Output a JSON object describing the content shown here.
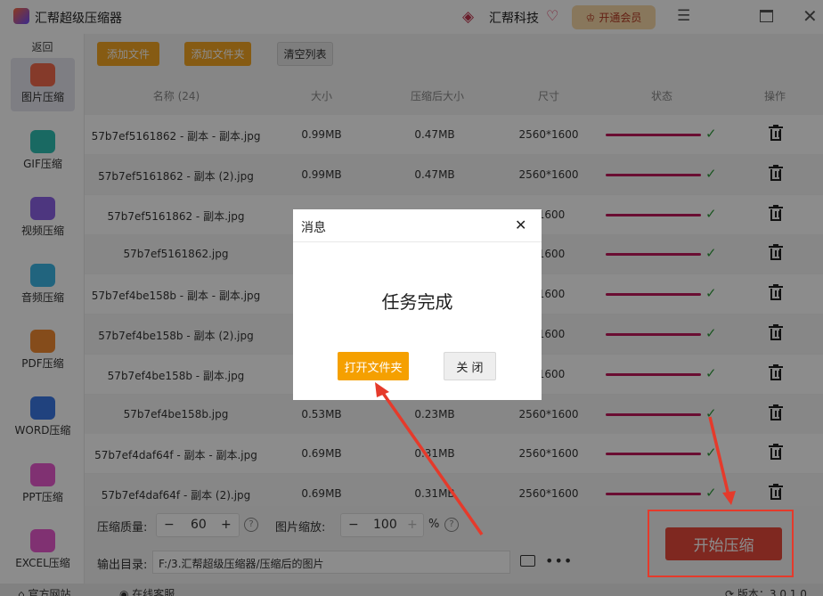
{
  "window": {
    "title": "汇帮超级压缩器",
    "brand": "汇帮科技",
    "vip_button": "开通会员"
  },
  "sidebar": {
    "back": "返回",
    "items": [
      {
        "label": "图片压缩",
        "icon": "image-compress-icon",
        "color": "#f36a4e",
        "active": true
      },
      {
        "label": "GIF压缩",
        "icon": "gif-compress-icon",
        "color": "#2fbfb3"
      },
      {
        "label": "视频压缩",
        "icon": "video-compress-icon",
        "color": "#8c63e8"
      },
      {
        "label": "音频压缩",
        "icon": "audio-compress-icon",
        "color": "#3db7e6"
      },
      {
        "label": "PDF压缩",
        "icon": "pdf-compress-icon",
        "color": "#f28a32"
      },
      {
        "label": "WORD压缩",
        "icon": "word-compress-icon",
        "color": "#3b79e6"
      },
      {
        "label": "PPT压缩",
        "icon": "ppt-compress-icon",
        "color": "#e95ad0"
      },
      {
        "label": "EXCEL压缩",
        "icon": "excel-compress-icon",
        "color": "#e95ad0"
      }
    ]
  },
  "toolbar": {
    "add_file": "添加文件",
    "add_folder": "添加文件夹",
    "clear_list": "清空列表"
  },
  "table": {
    "headers": {
      "name": "名称 (24)",
      "size": "大小",
      "compressed_size": "压缩后大小",
      "dimensions": "尺寸",
      "status": "状态",
      "action": "操作"
    },
    "rows": [
      {
        "name": "57b7ef5161862 - 副本 - 副本.jpg",
        "size": "0.99MB",
        "compressed": "0.47MB",
        "dims": "2560*1600",
        "progress": 1.0
      },
      {
        "name": "57b7ef5161862 - 副本 (2).jpg",
        "size": "0.99MB",
        "compressed": "0.47MB",
        "dims": "2560*1600",
        "progress": 1.0
      },
      {
        "name": "57b7ef5161862 - 副本.jpg",
        "size": "",
        "compressed": "",
        "dims": "*1600",
        "progress": 1.0
      },
      {
        "name": "57b7ef5161862.jpg",
        "size": "",
        "compressed": "",
        "dims": "*1600",
        "progress": 1.0
      },
      {
        "name": "57b7ef4be158b - 副本 - 副本.jpg",
        "size": "",
        "compressed": "",
        "dims": "*1600",
        "progress": 1.0
      },
      {
        "name": "57b7ef4be158b - 副本 (2).jpg",
        "size": "",
        "compressed": "",
        "dims": "*1600",
        "progress": 1.0
      },
      {
        "name": "57b7ef4be158b - 副本.jpg",
        "size": "",
        "compressed": "",
        "dims": "*1600",
        "progress": 1.0
      },
      {
        "name": "57b7ef4be158b.jpg",
        "size": "0.53MB",
        "compressed": "0.23MB",
        "dims": "2560*1600",
        "progress": 1.0
      },
      {
        "name": "57b7ef4daf64f - 副本 - 副本.jpg",
        "size": "0.69MB",
        "compressed": "0.31MB",
        "dims": "2560*1600",
        "progress": 1.0
      },
      {
        "name": "57b7ef4daf64f - 副本 (2).jpg",
        "size": "0.69MB",
        "compressed": "0.31MB",
        "dims": "2560*1600",
        "progress": 1.0
      }
    ]
  },
  "settings": {
    "quality_label": "压缩质量:",
    "quality_value": "60",
    "scale_label": "图片缩放:",
    "scale_value": "100",
    "scale_unit": "%",
    "output_label": "输出目录:",
    "output_path": "F:/3.汇帮超级压缩器/压缩后的图片",
    "start_button": "开始压缩"
  },
  "footer": {
    "website": "官方网站",
    "support": "在线客服",
    "version": "版本：3.0.1.0"
  },
  "dialog": {
    "title": "消息",
    "message": "任务完成",
    "open_folder": "打开文件夹",
    "close": "关 闭"
  },
  "colors": {
    "accent": "#f5a623",
    "start": "#e8493b",
    "progress": "#c2185b",
    "annotation": "#e53a2b"
  }
}
